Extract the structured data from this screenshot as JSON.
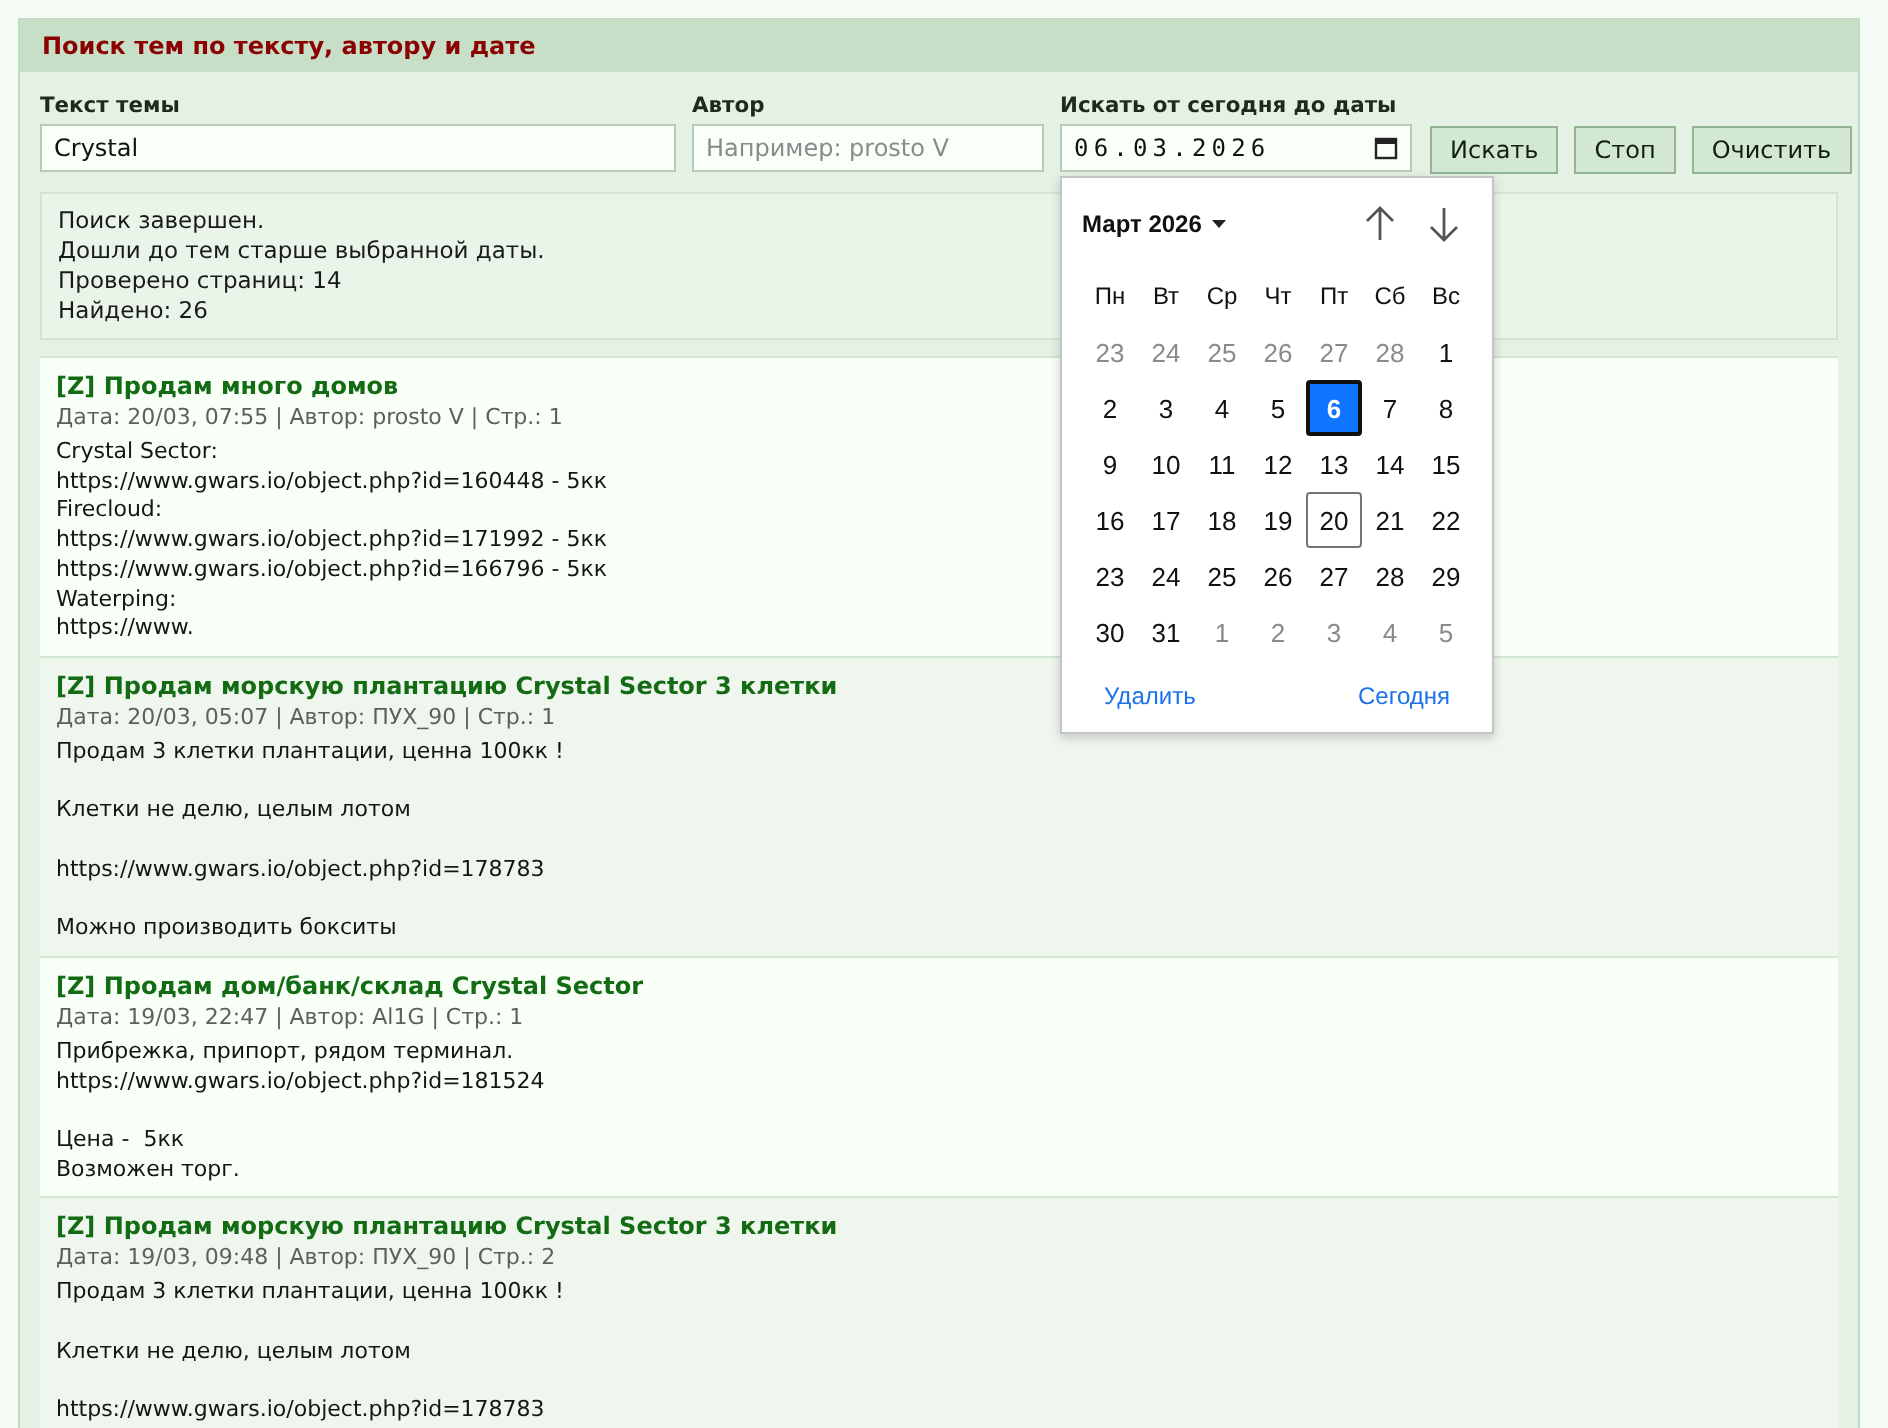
{
  "panel": {
    "title": "Поиск тем по тексту, автору и дате"
  },
  "fields": [
    {
      "kind": "text",
      "label": "Текст темы",
      "value": "Crystal"
    },
    {
      "kind": "text",
      "label": "Автор",
      "placeholder": "Например: prosto V"
    },
    {
      "kind": "date",
      "label": "Искать от сегодня до даты",
      "value": "06.03.2026",
      "expanded": true,
      "picker": {
        "month": "Март 2026",
        "weekdays": [
          "Пн",
          "Вт",
          "Ср",
          "Чт",
          "Пт",
          "Сб",
          "Вс"
        ],
        "days": [
          {
            "label": "23",
            "outside": true,
            "selected": false,
            "today": false
          },
          {
            "label": "24",
            "outside": true,
            "selected": false,
            "today": false
          },
          {
            "label": "25",
            "outside": true,
            "selected": false,
            "today": false
          },
          {
            "label": "26",
            "outside": true,
            "selected": false,
            "today": false
          },
          {
            "label": "27",
            "outside": true,
            "selected": false,
            "today": false
          },
          {
            "label": "28",
            "outside": true,
            "selected": false,
            "today": false
          },
          {
            "label": "1",
            "outside": false,
            "selected": false,
            "today": false
          },
          {
            "label": "2",
            "outside": false,
            "selected": false,
            "today": false
          },
          {
            "label": "3",
            "outside": false,
            "selected": false,
            "today": false
          },
          {
            "label": "4",
            "outside": false,
            "selected": false,
            "today": false
          },
          {
            "label": "5",
            "outside": false,
            "selected": false,
            "today": false
          },
          {
            "label": "6",
            "outside": false,
            "selected": true,
            "today": false
          },
          {
            "label": "7",
            "outside": false,
            "selected": false,
            "today": false
          },
          {
            "label": "8",
            "outside": false,
            "selected": false,
            "today": false
          },
          {
            "label": "9",
            "outside": false,
            "selected": false,
            "today": false
          },
          {
            "label": "10",
            "outside": false,
            "selected": false,
            "today": false
          },
          {
            "label": "11",
            "outside": false,
            "selected": false,
            "today": false
          },
          {
            "label": "12",
            "outside": false,
            "selected": false,
            "today": false
          },
          {
            "label": "13",
            "outside": false,
            "selected": false,
            "today": false
          },
          {
            "label": "14",
            "outside": false,
            "selected": false,
            "today": false
          },
          {
            "label": "15",
            "outside": false,
            "selected": false,
            "today": false
          },
          {
            "label": "16",
            "outside": false,
            "selected": false,
            "today": false
          },
          {
            "label": "17",
            "outside": false,
            "selected": false,
            "today": false
          },
          {
            "label": "18",
            "outside": false,
            "selected": false,
            "today": false
          },
          {
            "label": "19",
            "outside": false,
            "selected": false,
            "today": false
          },
          {
            "label": "20",
            "outside": false,
            "selected": false,
            "today": true
          },
          {
            "label": "21",
            "outside": false,
            "selected": false,
            "today": false
          },
          {
            "label": "22",
            "outside": false,
            "selected": false,
            "today": false
          },
          {
            "label": "23",
            "outside": false,
            "selected": false,
            "today": false
          },
          {
            "label": "24",
            "outside": false,
            "selected": false,
            "today": false
          },
          {
            "label": "25",
            "outside": false,
            "selected": false,
            "today": false
          },
          {
            "label": "26",
            "outside": false,
            "selected": false,
            "today": false
          },
          {
            "label": "27",
            "outside": false,
            "selected": false,
            "today": false
          },
          {
            "label": "28",
            "outside": false,
            "selected": false,
            "today": false
          },
          {
            "label": "29",
            "outside": false,
            "selected": false,
            "today": false
          },
          {
            "label": "30",
            "outside": false,
            "selected": false,
            "today": false
          },
          {
            "label": "31",
            "outside": false,
            "selected": false,
            "today": false
          },
          {
            "label": "1",
            "outside": true,
            "selected": false,
            "today": false
          },
          {
            "label": "2",
            "outside": true,
            "selected": false,
            "today": false
          },
          {
            "label": "3",
            "outside": true,
            "selected": false,
            "today": false
          },
          {
            "label": "4",
            "outside": true,
            "selected": false,
            "today": false
          },
          {
            "label": "5",
            "outside": true,
            "selected": false,
            "today": false
          }
        ],
        "actions": [
          "Удалить",
          "Сегодня"
        ]
      }
    }
  ],
  "buttons": [
    "Искать",
    "Стоп",
    "Очистить"
  ],
  "status_lines": [
    "Поиск завершен.",
    "Дошли до тем старше выбранной даты.",
    "Проверено страниц: 14",
    "Найдено: 26"
  ],
  "posts": [
    {
      "title": "[Z] Продам много домов",
      "meta": "Дата: 20/03, 07:55 | Автор: prosto V | Стр.: 1",
      "paragraphs": [
        [
          "Crystal Sector:",
          "https://www.gwars.io/object.php?id=160448 - 5кк",
          "Firecloud:",
          "https://www.gwars.io/object.php?id=171992 - 5кк",
          "https://www.gwars.io/object.php?id=166796 - 5кк",
          "Waterping:",
          "https://www."
        ]
      ]
    },
    {
      "title": "[Z] Продам морскую плантацию Crystal Sector 3 клетки",
      "meta": "Дата: 20/03, 05:07 | Автор: ПУХ_90 | Стр.: 1",
      "paragraphs": [
        [
          "Продам 3 клетки плантации, ценна 100кк !"
        ],
        [
          "Клетки не делю, целым лотом"
        ],
        [
          "https://www.gwars.io/object.php?id=178783"
        ],
        [
          "Можно производить бокситы"
        ]
      ]
    },
    {
      "title": "[Z] Продам дом/банк/склад Crystal Sector",
      "meta": "Дата: 19/03, 22:47 | Автор: Al1G | Стр.: 1",
      "paragraphs": [
        [
          "Прибрежка, припорт, рядом терминал.",
          "https://www.gwars.io/object.php?id=181524"
        ],
        [
          "Цена -  5кк",
          "Возможен торг."
        ]
      ]
    },
    {
      "title": "[Z] Продам морскую плантацию Crystal Sector 3 клетки",
      "meta": "Дата: 19/03, 09:48 | Автор: ПУХ_90 | Стр.: 2",
      "paragraphs": [
        [
          "Продам 3 клетки плантации, ценна 100кк !"
        ],
        [
          "Клетки не делю, целым лотом"
        ],
        [
          "https://www.gwars.io/object.php?id=178783"
        ]
      ]
    }
  ]
}
